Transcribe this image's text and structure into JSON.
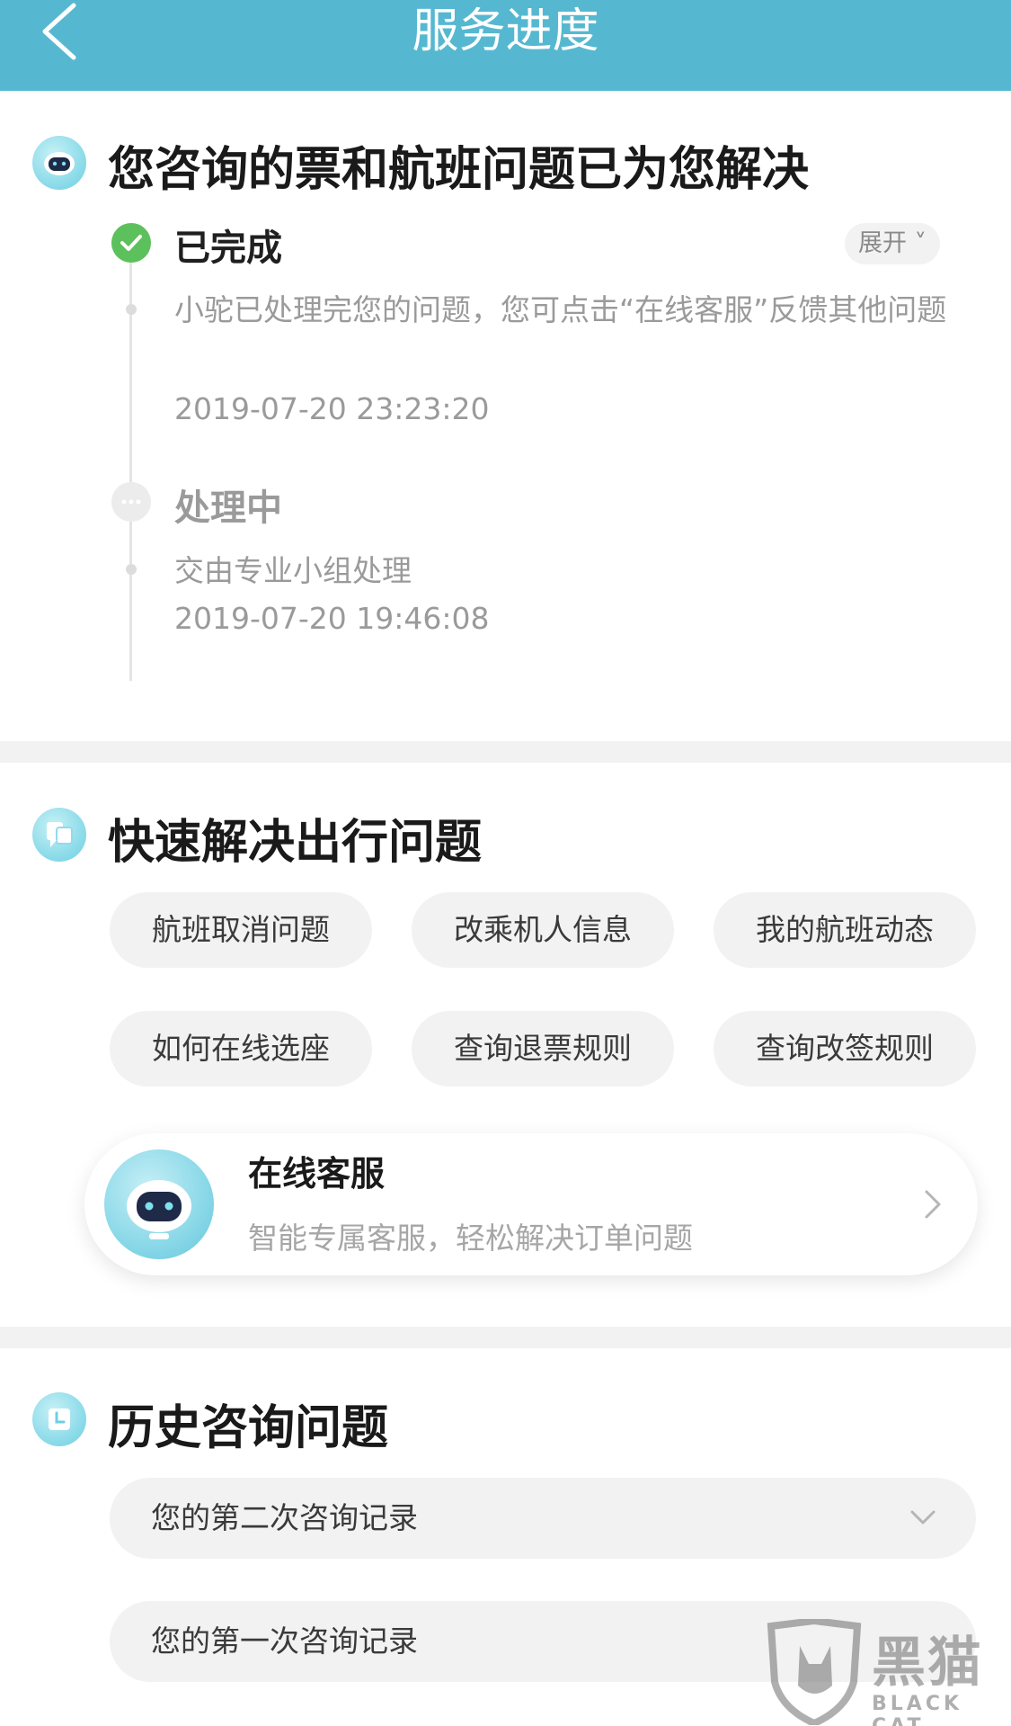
{
  "header": {
    "title": "服务进度"
  },
  "progress": {
    "heading": "您咨询的票和航班问题已为您解决",
    "expand_label": "展开 ˅",
    "steps": [
      {
        "title": "已完成",
        "status": "done",
        "detail": "小驼已处理完您的问题，您可点击“在线客服”反馈其他问题",
        "time": "2019-07-20 23:23:20"
      },
      {
        "title": "处理中",
        "status": "pending",
        "detail": "交由专业小组处理",
        "time": "2019-07-20 19:46:08"
      }
    ]
  },
  "quick": {
    "heading": "快速解决出行问题",
    "chips": [
      "航班取消问题",
      "改乘机人信息",
      "我的航班动态",
      "如何在线选座",
      "查询退票规则",
      "查询改签规则"
    ]
  },
  "service": {
    "title": "在线客服",
    "subtitle": "智能专属客服，轻松解决订单问题"
  },
  "history": {
    "heading": "历史咨询问题",
    "items": [
      "您的第二次咨询记录",
      "您的第一次咨询记录"
    ]
  },
  "watermark": {
    "text": "黑猫",
    "sub": "BLACK CAT"
  },
  "colors": {
    "header_bg": "#56b8d0",
    "done_green": "#5cc05c",
    "chip_bg": "#f2f2f2"
  }
}
